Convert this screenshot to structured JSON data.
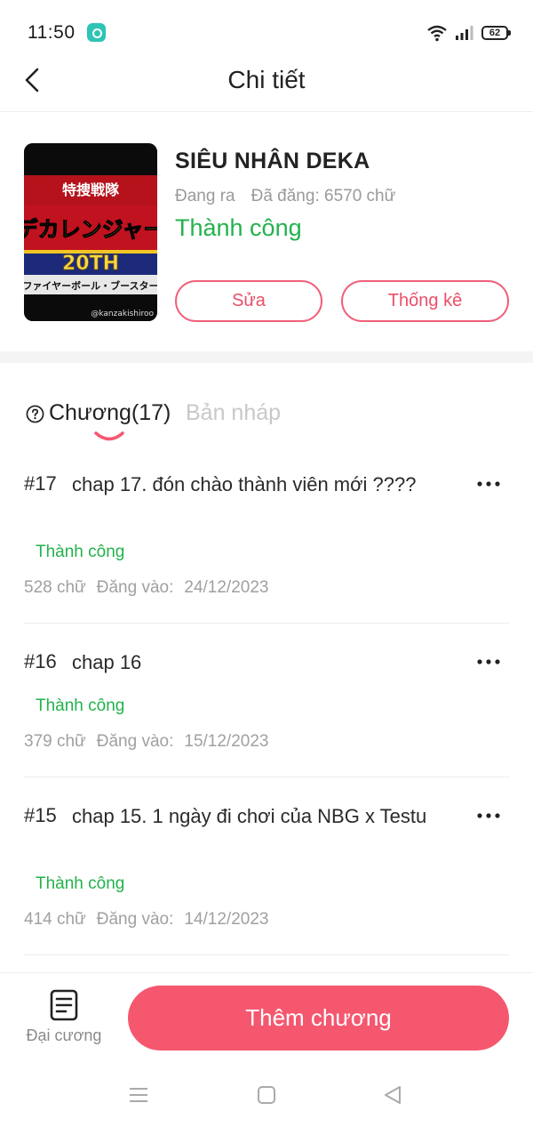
{
  "status_bar": {
    "time": "11:50",
    "battery": "62"
  },
  "header": {
    "title": "Chi tiết",
    "back_icon": "chevron-left-icon"
  },
  "story": {
    "title": "SIÊU NHÂN DEKA",
    "state": "Đang ra",
    "posted": "Đã đăng: 6570 chữ",
    "status": "Thành công",
    "edit_label": "Sửa",
    "stats_label": "Thống kê",
    "cover": {
      "line1": "特捜戦隊",
      "line2": "デカレンジャー",
      "line3": "20TH",
      "line4": "ファイヤーボール・ブースター",
      "watermark": "@kanzakishiroo"
    }
  },
  "tabs": {
    "chapters": "Chương(17)",
    "drafts": "Bản nháp"
  },
  "chapters": [
    {
      "num": "#17",
      "title": "chap 17. đón chào thành viên mới ????",
      "status": "Thành công",
      "words": "528 chữ",
      "posted_label": "Đăng vào:",
      "date": "24/12/2023"
    },
    {
      "num": "#16",
      "title": "chap 16",
      "status": "Thành công",
      "words": "379 chữ",
      "posted_label": "Đăng vào:",
      "date": "15/12/2023"
    },
    {
      "num": "#15",
      "title": "chap 15. 1 ngày đi chơi của NBG x Testu",
      "status": "Thành công",
      "words": "414 chữ",
      "posted_label": "Đăng vào:",
      "date": "14/12/2023"
    }
  ],
  "bottom": {
    "outline_label": "Đại cương",
    "add_label": "Thêm chương"
  },
  "colors": {
    "accent": "#f5576f",
    "success": "#22b24c",
    "muted": "#a0a0a0"
  }
}
